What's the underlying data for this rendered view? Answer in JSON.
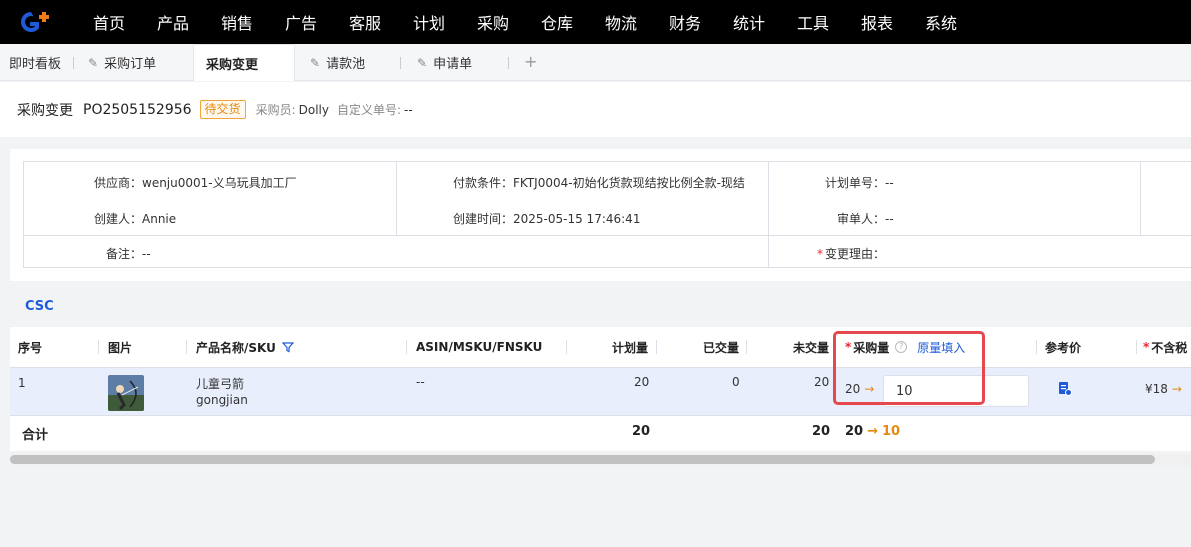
{
  "nav": {
    "items": [
      "首页",
      "产品",
      "销售",
      "广告",
      "客服",
      "计划",
      "采购",
      "仓库",
      "物流",
      "财务",
      "统计",
      "工具",
      "报表",
      "系统"
    ]
  },
  "tabs": {
    "items": [
      "即时看板",
      "采购订单",
      "采购变更",
      "请款池",
      "申请单"
    ],
    "add": "+"
  },
  "header": {
    "title": "采购变更",
    "po_number": "PO2505152956",
    "status": "待交货",
    "buyer_label": "采购员:",
    "buyer": "Dolly",
    "custom_no_label": "自定义单号:",
    "custom_no": "--"
  },
  "info": {
    "supplier": "供应商：wenju0001-义乌玩具加工厂",
    "payment": "付款条件：FKTJ0004-初始化货款现结按比例全款-现结",
    "plan_no": "计划单号：--",
    "creator": "创建人：Annie",
    "created_time": "创建时间：2025-05-15 17:46:41",
    "reviewer": "审单人：--",
    "remark": "备注：--",
    "change_reason": "变更理由："
  },
  "section_label": "CSC",
  "table": {
    "headers": {
      "seq": "序号",
      "image": "图片",
      "product": "产品名称/SKU",
      "asin": "ASIN/MSKU/FNSKU",
      "planned": "计划量",
      "delivered": "已交量",
      "undelivered": "未交量",
      "purchase_qty": "采购量",
      "fill_original": "原量填入",
      "ref_price": "参考价",
      "untaxed": "不含税"
    },
    "row": {
      "seq": "1",
      "name": "儿童弓箭",
      "sku": "gongjian",
      "asin": "--",
      "planned": "20",
      "delivered": "0",
      "undelivered": "20",
      "orig_qty": "20",
      "new_qty": "10",
      "price": "¥18"
    },
    "total": {
      "label": "合计",
      "planned": "20",
      "undelivered": "20",
      "orig_qty": "20",
      "new_qty": "10"
    }
  },
  "arrow": "→",
  "colors": {
    "accent": "#1f5bd8",
    "status_orange": "#e58a0f",
    "highlight_red": "#e5484d",
    "nav_bg": "#000000"
  }
}
